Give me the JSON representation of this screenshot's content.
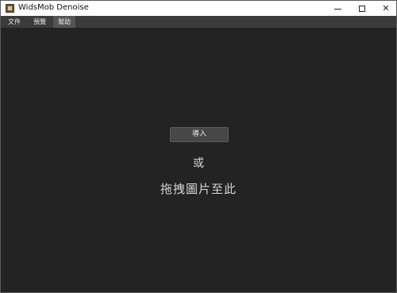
{
  "window": {
    "title": "WidsMob Denoise",
    "icon": "app-icon",
    "controls": [
      "minimize-icon",
      "maximize-icon",
      "close-icon"
    ],
    "close_glyph": "✕"
  },
  "menubar": {
    "items": [
      {
        "label": "文件"
      },
      {
        "label": "預覽"
      },
      {
        "label": "幫助"
      }
    ]
  },
  "main": {
    "import_button": "導入",
    "or_text": "或",
    "drag_hint": "拖拽圖片至此"
  },
  "colors": {
    "background": "#232323",
    "menubar": "#3b3b3b",
    "active_menu": "#555555",
    "button": "#474747"
  }
}
